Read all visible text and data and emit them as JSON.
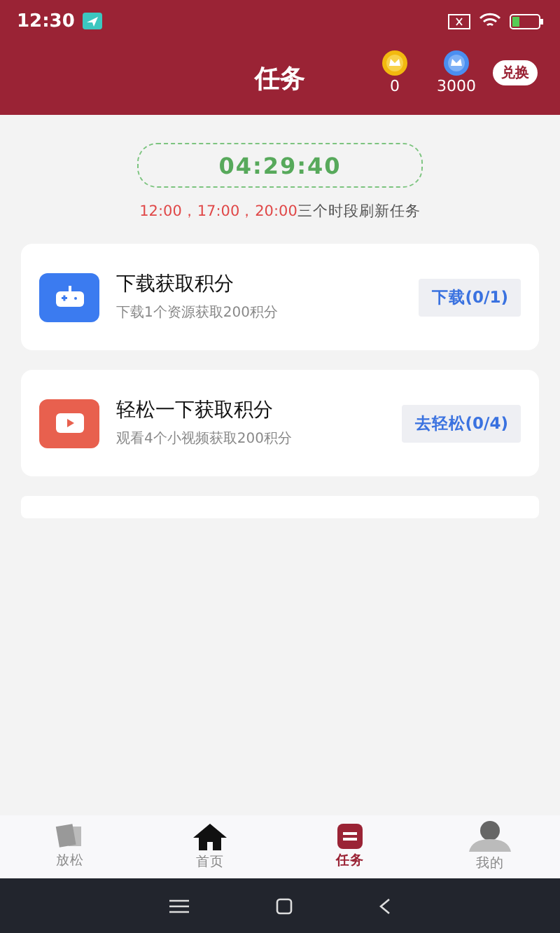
{
  "status_bar": {
    "time": "12:30"
  },
  "header": {
    "title": "任务",
    "balances": [
      {
        "kind": "gold",
        "amount": "0"
      },
      {
        "kind": "blue",
        "amount": "3000"
      }
    ],
    "exchange_button": "兑换"
  },
  "countdown": {
    "time": "04:29:40",
    "note_times": "12:00，17:00，20:00",
    "note_text": "三个时段刷新任务"
  },
  "tasks": [
    {
      "kind": "game",
      "title": "下载获取积分",
      "description": "下载1个资源获取200积分",
      "action": "下载(0/1)"
    },
    {
      "kind": "video",
      "title": "轻松一下获取积分",
      "description": "观看4个小视频获取200积分",
      "action": "去轻松(0/4)"
    }
  ],
  "tab_bar": [
    {
      "kind": "relax",
      "label": "放松",
      "selected": false
    },
    {
      "kind": "home",
      "label": "首页",
      "selected": false
    },
    {
      "kind": "task",
      "label": "任务",
      "selected": true
    },
    {
      "kind": "profile",
      "label": "我的",
      "selected": false
    }
  ]
}
